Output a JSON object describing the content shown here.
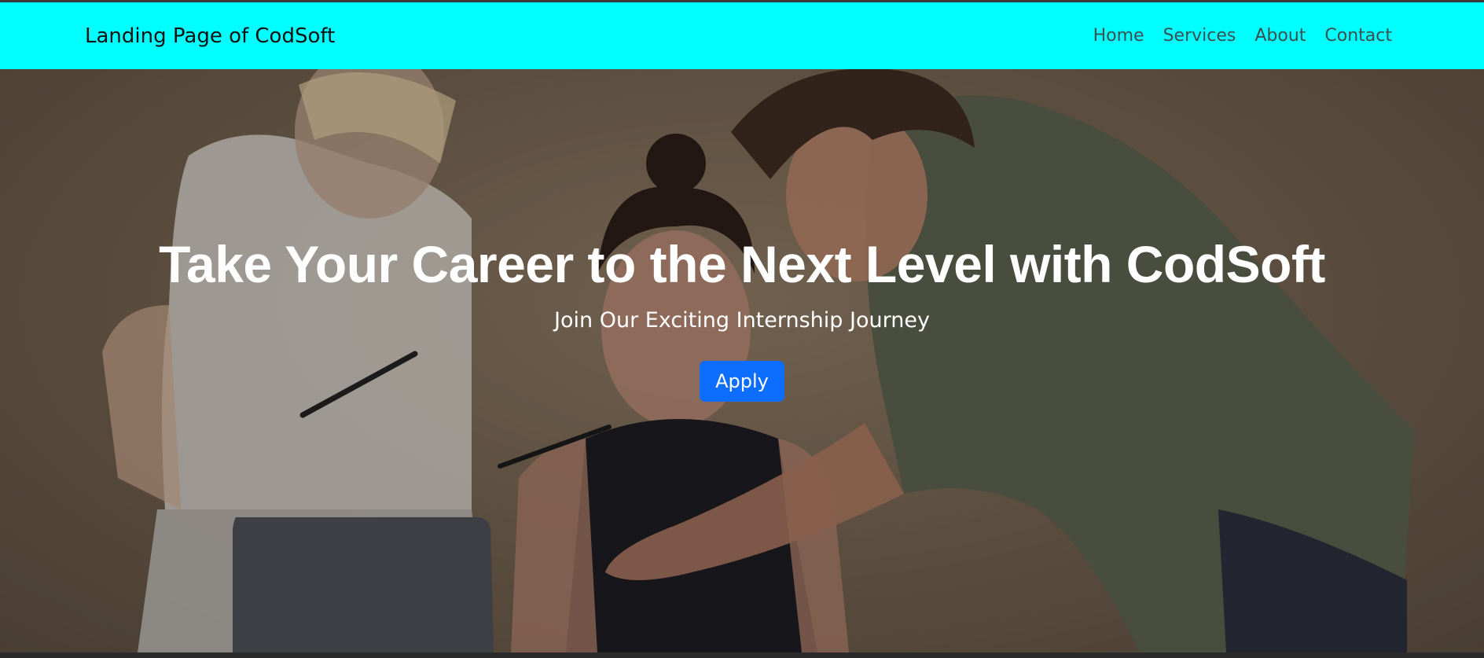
{
  "navbar": {
    "brand": "Landing Page of CodSoft",
    "links": [
      "Home",
      "Services",
      "About",
      "Contact"
    ],
    "background": "#00ffff"
  },
  "hero": {
    "title": "Take Your Career to the Next Level with CodSoft",
    "subtitle": "Join Our Exciting Internship Journey",
    "cta_label": "Apply",
    "cta_color": "#0d6efd"
  }
}
